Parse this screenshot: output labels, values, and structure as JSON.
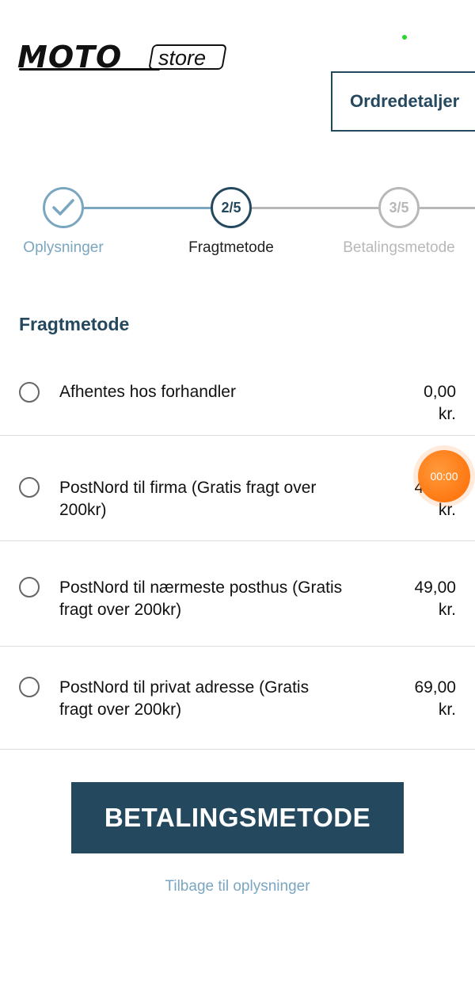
{
  "brand": {
    "logo_main": "MOTO",
    "logo_sub": "store"
  },
  "header": {
    "order_details_label": "Ordredetaljer"
  },
  "steps": [
    {
      "label": "Oplysninger",
      "badge": "",
      "state": "done"
    },
    {
      "label": "Fragtmetode",
      "badge": "2/5",
      "state": "current"
    },
    {
      "label": "Betalingsmetode",
      "badge": "3/5",
      "state": "upcoming"
    }
  ],
  "section": {
    "title": "Fragtmetode"
  },
  "shipping": [
    {
      "name": "Afhentes hos forhandler",
      "price": "0,00",
      "unit": "kr."
    },
    {
      "name": "PostNord til firma (Gratis fragt over 200kr)",
      "price": "49,00",
      "unit": "kr."
    },
    {
      "name": "PostNord til nærmeste posthus (Gratis fragt over 200kr)",
      "price": "49,00",
      "unit": "kr."
    },
    {
      "name": "PostNord til privat adresse (Gratis fragt over 200kr)",
      "price": "69,00",
      "unit": "kr."
    }
  ],
  "timer": {
    "text": "00:00"
  },
  "actions": {
    "primary_label": "BETALINGSMETODE",
    "back_label": "Tilbage til oplysninger"
  },
  "colors": {
    "primary": "#24485e",
    "done": "#7aa6c0",
    "muted": "#b8b8b8",
    "timer": "#ff7a1a"
  }
}
